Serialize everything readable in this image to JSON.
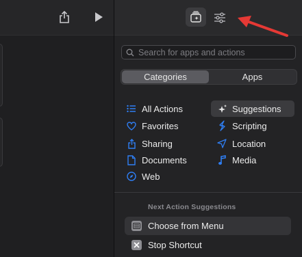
{
  "library": {
    "search_placeholder": "Search for apps and actions",
    "segments": [
      {
        "label": "Categories",
        "active": true
      },
      {
        "label": "Apps",
        "active": false
      }
    ],
    "categories_left": [
      {
        "label": "All Actions",
        "icon": "list-icon"
      },
      {
        "label": "Favorites",
        "icon": "heart-icon"
      },
      {
        "label": "Sharing",
        "icon": "share-icon"
      },
      {
        "label": "Documents",
        "icon": "document-icon"
      },
      {
        "label": "Web",
        "icon": "compass-icon"
      }
    ],
    "categories_right": [
      {
        "label": "Suggestions",
        "icon": "sparkles-icon",
        "selected": true
      },
      {
        "label": "Scripting",
        "icon": "scripting-icon"
      },
      {
        "label": "Location",
        "icon": "location-arrow-icon"
      },
      {
        "label": "Media",
        "icon": "music-note-icon"
      }
    ],
    "section_title": "Next Action Suggestions",
    "suggestions": [
      {
        "label": "Choose from Menu",
        "icon": "menu-icon"
      },
      {
        "label": "Stop Shortcut",
        "icon": "stop-icon"
      }
    ]
  },
  "colors": {
    "accent_blue": "#2f7ff5",
    "annotation_arrow": "#e53935"
  }
}
